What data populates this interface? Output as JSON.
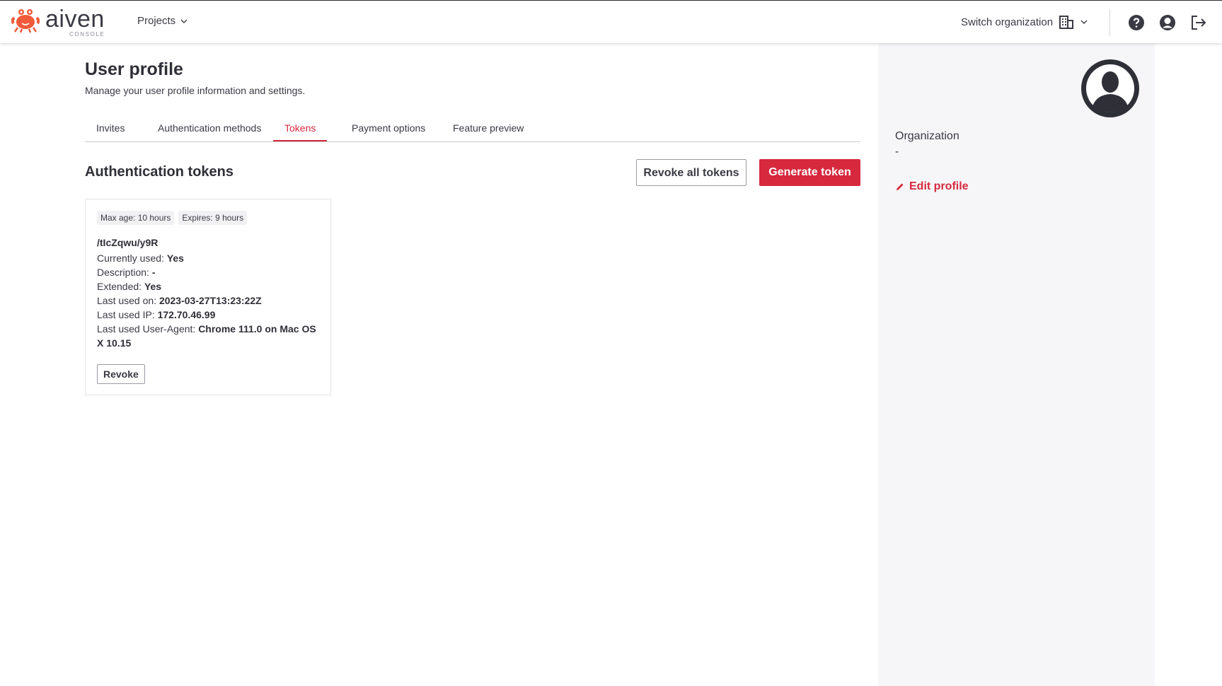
{
  "header": {
    "logo_text": "aiven",
    "logo_sub": "CONSOLE",
    "projects_label": "Projects",
    "switch_org_label": "Switch organization",
    "icons": [
      "help-icon",
      "user-circle-icon",
      "logout-icon"
    ]
  },
  "page": {
    "title": "User profile",
    "subtitle": "Manage your user profile information and settings."
  },
  "tabs": [
    {
      "label": "Invites",
      "active": false
    },
    {
      "label": "Authentication methods",
      "active": false
    },
    {
      "label": "Tokens",
      "active": true
    },
    {
      "label": "Payment options",
      "active": false
    },
    {
      "label": "Feature preview",
      "active": false
    }
  ],
  "tokens_section": {
    "title": "Authentication tokens",
    "revoke_all_label": "Revoke all tokens",
    "generate_label": "Generate token"
  },
  "token": {
    "max_age": "Max age: 10 hours",
    "expires": "Expires: 9 hours",
    "id": "/tIcZqwu/y9R",
    "currently_used_label": "Currently used:",
    "currently_used": "Yes",
    "description_label": "Description:",
    "description": "-",
    "extended_label": "Extended:",
    "extended": "Yes",
    "last_used_on_label": "Last used on:",
    "last_used_on": "2023-03-27T13:23:22Z",
    "last_used_ip_label": "Last used IP:",
    "last_used_ip": "172.70.46.99",
    "user_agent_label": "Last used User-Agent:",
    "user_agent": "Chrome 111.0 on Mac OS X 10.15",
    "revoke_label": "Revoke"
  },
  "sidebar": {
    "organization_label": "Organization",
    "organization_value": "-",
    "edit_profile_label": "Edit profile"
  },
  "colors": {
    "accent": "#d6293e",
    "text": "#3a3a44",
    "panel_bg": "#f6f6f8"
  }
}
